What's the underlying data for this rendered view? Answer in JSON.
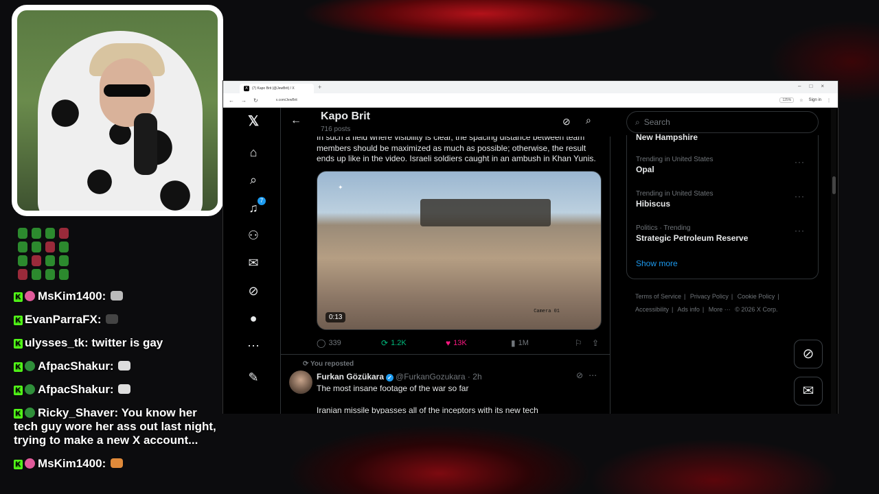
{
  "chat": {
    "messages": [
      {
        "user": "MsKim1400",
        "text": "",
        "avatar_color": "#e05a9a"
      },
      {
        "user": "EvanParraFX",
        "text": "",
        "avatar_color": ""
      },
      {
        "user": "ulysses_tk",
        "text": "twitter is gay",
        "avatar_color": ""
      },
      {
        "user": "AfpacShakur",
        "text": "",
        "avatar_color": "#2f8f3a"
      },
      {
        "user": "AfpacShakur",
        "text": "",
        "avatar_color": "#2f8f3a"
      },
      {
        "user": "Ricky_Shaver",
        "text": "You know her tech guy wore her ass out last night, trying to make a new X account...",
        "avatar_color": "#2f8f3a"
      },
      {
        "user": "MsKim1400",
        "text": "",
        "avatar_color": "#e05a9a"
      }
    ]
  },
  "browser": {
    "tab_title": "(7) Kapo Brit (@JewBrit) / X",
    "url": "x.com/JewBrit",
    "zoom": "125%",
    "signin": "Sign in"
  },
  "profile": {
    "name": "Kapo Brit",
    "posts": "716 posts"
  },
  "nav": {
    "notification_count": "7"
  },
  "tweet1": {
    "text": "In such a field where visibility is clear, the spacing distance between team members should be maximized as much as possible; otherwise, the result ends up like in the video. Israeli soldiers caught in an ambush in Khan Yunis.",
    "video_duration": "0:13",
    "video_overlay": "Camera 01",
    "replies": "339",
    "reposts": "1.2K",
    "likes": "13K",
    "views": "1M"
  },
  "tweet2": {
    "repost_label": "You reposted",
    "name": "Furkan Gözükara",
    "handle": "@FurkanGozukara",
    "time": "2h",
    "text": "The most insane footage of the war so far",
    "text2": "Iranian missile bypasses all of the inceptors with its new tech"
  },
  "sidebar": {
    "search_placeholder": "Search",
    "top_trend": "New Hampshire",
    "trends": [
      {
        "category": "Trending in United States",
        "name": "Opal"
      },
      {
        "category": "Trending in United States",
        "name": "Hibiscus"
      },
      {
        "category": "Politics · Trending",
        "name": "Strategic Petroleum Reserve"
      }
    ],
    "show_more": "Show more",
    "footer": [
      "Terms of Service",
      "Privacy Policy",
      "Cookie Policy",
      "Accessibility",
      "Ads info",
      "More ···",
      "© 2026 X Corp."
    ]
  },
  "colors": {
    "accent": "#1d9bf0",
    "like": "#f91880",
    "repost": "#00ba7c"
  }
}
